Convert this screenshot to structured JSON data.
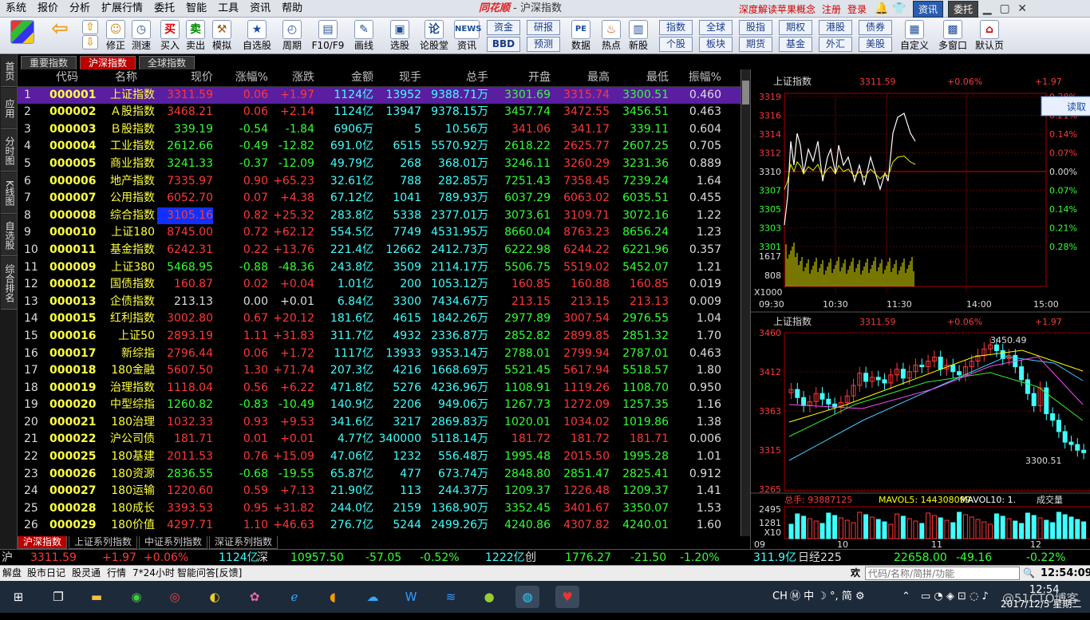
{
  "menu": {
    "items": [
      "系统",
      "报价",
      "分析",
      "扩展行情",
      "委托",
      "智能",
      "工具",
      "资讯",
      "帮助"
    ],
    "logo": "同花顺",
    "title": " - 沪深指数",
    "promo": "深度解读苹果概念",
    "register": "注册",
    "login": "登录",
    "zixun": "资讯",
    "weituo": "委托"
  },
  "toolbar": {
    "items": [
      "修正",
      "测速",
      "买入",
      "卖出",
      "模拟",
      "自选股",
      "周期",
      "F10/F9",
      "画线",
      "选股",
      "论股堂",
      "资讯"
    ],
    "items2": [
      "数据",
      "热点",
      "新股",
      "自定义",
      "多窗口",
      "默认页"
    ],
    "small": [
      "资金",
      "研报",
      "BBD",
      "预测",
      "指数",
      "全球",
      "股指",
      "期权",
      "港股",
      "债券",
      "个股",
      "板块",
      "期货",
      "基金",
      "外汇",
      "美股"
    ]
  },
  "leftnav": [
    "首页",
    "应用",
    "分时图",
    "K线图",
    "自选股",
    "综合排名"
  ],
  "tabs": [
    "重要指数",
    "沪深指数",
    "全球指数"
  ],
  "columns": [
    "代码",
    "名称",
    "现价",
    "涨幅%",
    "涨跌",
    "金额",
    "现手",
    "总手",
    "开盘",
    "最高",
    "最低",
    "振幅%"
  ],
  "rows": [
    [
      "1",
      "000001",
      "上证指数",
      "3311.59",
      "0.06",
      "+1.97",
      "1124亿",
      "13952",
      "9388.71万",
      "3301.69",
      "3315.74",
      "3300.51",
      "0.460"
    ],
    [
      "2",
      "000002",
      "Ａ股指数",
      "3468.21",
      "0.06",
      "+2.14",
      "1124亿",
      "13947",
      "9378.15万",
      "3457.74",
      "3472.55",
      "3456.51",
      "0.463"
    ],
    [
      "3",
      "000003",
      "Ｂ股指数",
      "339.19",
      "-0.54",
      "-1.84",
      "6906万",
      "5",
      "10.56万",
      "341.06",
      "341.17",
      "339.11",
      "0.604"
    ],
    [
      "4",
      "000004",
      "工业指数",
      "2612.66",
      "-0.49",
      "-12.82",
      "691.0亿",
      "6515",
      "5570.92万",
      "2618.22",
      "2625.77",
      "2607.25",
      "0.705"
    ],
    [
      "5",
      "000005",
      "商业指数",
      "3241.33",
      "-0.37",
      "-12.09",
      "49.79亿",
      "268",
      "368.01万",
      "3246.11",
      "3260.29",
      "3231.36",
      "0.889"
    ],
    [
      "6",
      "000006",
      "地产指数",
      "7335.97",
      "0.90",
      "+65.23",
      "32.61亿",
      "788",
      "282.85万",
      "7251.43",
      "7358.45",
      "7239.24",
      "1.64"
    ],
    [
      "7",
      "000007",
      "公用指数",
      "6052.70",
      "0.07",
      "+4.38",
      "67.12亿",
      "1041",
      "789.93万",
      "6037.29",
      "6063.02",
      "6035.51",
      "0.455"
    ],
    [
      "8",
      "000008",
      "综合指数",
      "3105.16",
      "0.82",
      "+25.32",
      "283.8亿",
      "5338",
      "2377.01万",
      "3073.61",
      "3109.71",
      "3072.16",
      "1.22"
    ],
    [
      "9",
      "000010",
      "上证180",
      "8745.00",
      "0.72",
      "+62.12",
      "554.5亿",
      "7749",
      "4531.95万",
      "8660.04",
      "8763.23",
      "8656.24",
      "1.23"
    ],
    [
      "10",
      "000011",
      "基金指数",
      "6242.31",
      "0.22",
      "+13.76",
      "221.4亿",
      "12662",
      "2412.73万",
      "6222.98",
      "6244.22",
      "6221.96",
      "0.357"
    ],
    [
      "11",
      "000009",
      "上证380",
      "5468.95",
      "-0.88",
      "-48.36",
      "243.8亿",
      "3509",
      "2114.17万",
      "5506.75",
      "5519.02",
      "5452.07",
      "1.21"
    ],
    [
      "12",
      "000012",
      "国债指数",
      "160.87",
      "0.02",
      "+0.04",
      "1.01亿",
      "200",
      "1053.12万",
      "160.85",
      "160.88",
      "160.85",
      "0.019"
    ],
    [
      "13",
      "000013",
      "企债指数",
      "213.13",
      "0.00",
      "+0.01",
      "6.84亿",
      "3300",
      "7434.67万",
      "213.15",
      "213.15",
      "213.13",
      "0.009"
    ],
    [
      "14",
      "000015",
      "红利指数",
      "3002.80",
      "0.67",
      "+20.12",
      "181.6亿",
      "4615",
      "1842.26万",
      "2977.89",
      "3007.54",
      "2976.55",
      "1.04"
    ],
    [
      "15",
      "000016",
      "上证50",
      "2893.19",
      "1.11",
      "+31.83",
      "311.7亿",
      "4932",
      "2336.87万",
      "2852.82",
      "2899.85",
      "2851.32",
      "1.70"
    ],
    [
      "16",
      "000017",
      "新综指",
      "2796.44",
      "0.06",
      "+1.72",
      "1117亿",
      "13933",
      "9353.14万",
      "2788.01",
      "2799.94",
      "2787.01",
      "0.463"
    ],
    [
      "17",
      "000018",
      "180金融",
      "5607.50",
      "1.30",
      "+71.74",
      "207.3亿",
      "4216",
      "1668.69万",
      "5521.45",
      "5617.94",
      "5518.57",
      "1.80"
    ],
    [
      "18",
      "000019",
      "治理指数",
      "1118.04",
      "0.56",
      "+6.22",
      "471.8亿",
      "5276",
      "4236.96万",
      "1108.91",
      "1119.26",
      "1108.70",
      "0.950"
    ],
    [
      "19",
      "000020",
      "中型综指",
      "1260.82",
      "-0.83",
      "-10.49",
      "140.9亿",
      "2206",
      "949.06万",
      "1267.73",
      "1272.09",
      "1257.35",
      "1.16"
    ],
    [
      "20",
      "000021",
      "180治理",
      "1032.33",
      "0.93",
      "+9.53",
      "341.6亿",
      "3217",
      "2869.83万",
      "1020.01",
      "1034.02",
      "1019.86",
      "1.38"
    ],
    [
      "21",
      "000022",
      "沪公司债",
      "181.71",
      "0.01",
      "+0.01",
      "4.77亿",
      "340000",
      "5118.14万",
      "181.72",
      "181.72",
      "181.71",
      "0.006"
    ],
    [
      "22",
      "000025",
      "180基建",
      "2011.53",
      "0.76",
      "+15.09",
      "47.06亿",
      "1232",
      "556.48万",
      "1995.48",
      "2015.50",
      "1995.28",
      "1.01"
    ],
    [
      "23",
      "000026",
      "180资源",
      "2836.55",
      "-0.68",
      "-19.55",
      "65.87亿",
      "477",
      "673.74万",
      "2848.80",
      "2851.47",
      "2825.41",
      "0.912"
    ],
    [
      "24",
      "000027",
      "180运输",
      "1220.60",
      "0.59",
      "+7.13",
      "21.90亿",
      "113",
      "244.37万",
      "1209.37",
      "1226.48",
      "1209.37",
      "1.41"
    ],
    [
      "25",
      "000028",
      "180成长",
      "3393.53",
      "0.95",
      "+31.82",
      "244.0亿",
      "2159",
      "1368.90万",
      "3352.45",
      "3401.67",
      "3350.07",
      "1.53"
    ],
    [
      "26",
      "000029",
      "180价值",
      "4297.71",
      "1.10",
      "+46.63",
      "276.7亿",
      "5244",
      "2499.26万",
      "4240.86",
      "4307.82",
      "4240.01",
      "1.60"
    ]
  ],
  "bottom_tabs": [
    "沪深指数",
    "上证系列指数",
    "中证系列指数",
    "深证系列指数"
  ],
  "intraday": {
    "name": "上证指数",
    "price": "3311.59",
    "pct": "+0.06%",
    "chg": "+1.97",
    "y_labels": [
      "3319",
      "3316",
      "3314",
      "3312",
      "3310",
      "3307",
      "3305",
      "3303",
      "3301"
    ],
    "pct_labels": [
      "0.28%",
      "0.21%",
      "0.14%",
      "0.07%",
      "0.00%",
      "0.07%",
      "0.14%",
      "0.21%",
      "0.28%"
    ],
    "vol_labels": [
      "1617",
      "808"
    ],
    "x1000": "X1000",
    "x_labels": [
      "09:30",
      "10:30",
      "11:30",
      "14:00",
      "15:00"
    ],
    "readbtn": "读取"
  },
  "kline": {
    "name": "上证指数",
    "price": "3311.59",
    "pct": "+0.06%",
    "chg": "+1.97",
    "y_labels": [
      "3460",
      "3412",
      "3363",
      "3315",
      "3265"
    ],
    "hi_mark": "3450.49",
    "lo_mark": "3300.51",
    "vol_total": "总手: 93887125",
    "mavol5": "MAVOL5: 144308099",
    "mavol10": "MAVOL10: 1.",
    "volname": "成交量",
    "vol_y": [
      "2495",
      "1281",
      "X10"
    ],
    "x_labels": [
      "09",
      "10",
      "11",
      "12"
    ]
  },
  "ticker": {
    "sh_label": "沪",
    "sh_price": "3311.59",
    "sh_chg": "+1.97",
    "sh_pct": "+0.06%",
    "sh_amt": "1124亿",
    "sz_label": "深",
    "sz_price": "10957.50",
    "sz_chg": "-57.05",
    "sz_pct": "-0.52%",
    "sz_amt": "1222亿",
    "cy_label": "创",
    "cy_price": "1776.27",
    "cy_chg": "-21.50",
    "cy_pct": "-1.20%",
    "cy_amt": "311.9亿",
    "nk_label": "日经225",
    "nk_price": "22658.00",
    "nk_chg": "-49.16",
    "nk_pct": "-0.22%"
  },
  "status": {
    "items": [
      "解盘",
      "股市日记",
      "股灵通",
      "行情",
      "7*24小时",
      "智能问答[反馈]"
    ],
    "search_placeholder": "代码/名称/简拼/功能",
    "huan": "欢",
    "time": "12:54:09"
  },
  "taskbar": {
    "ime": "CH",
    "time": "12:54",
    "date": "2017/12/5 星期二",
    "watermark": "@51CTO博客"
  }
}
